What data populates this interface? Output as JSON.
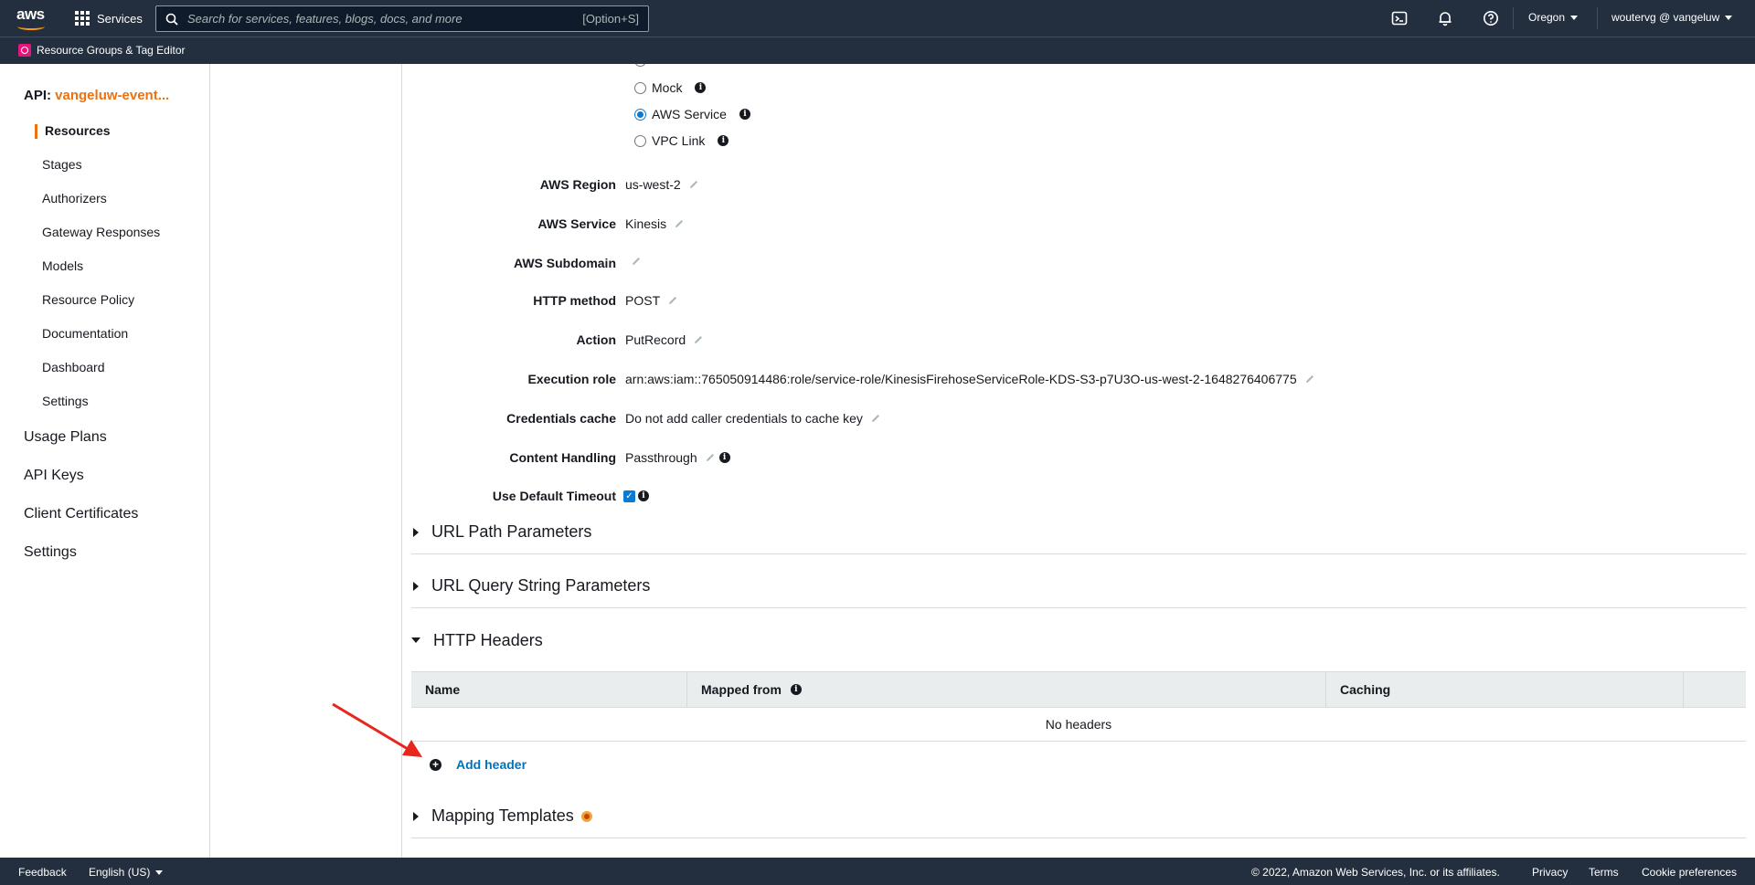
{
  "topnav": {
    "logo_text": "aws",
    "services_label": "Services",
    "search_placeholder": "Search for services, features, blogs, docs, and more",
    "search_shortcut": "[Option+S]",
    "region": "Oregon",
    "user": "woutervg @ vangeluw"
  },
  "subnav": {
    "resource_groups_label": "Resource Groups & Tag Editor"
  },
  "sidebar": {
    "api_prefix": "API:",
    "api_name": "vangeluw-event...",
    "items": [
      "Resources",
      "Stages",
      "Authorizers",
      "Gateway Responses",
      "Models",
      "Resource Policy",
      "Documentation",
      "Dashboard",
      "Settings"
    ],
    "top_items": [
      "Usage Plans",
      "API Keys",
      "Client Certificates",
      "Settings"
    ]
  },
  "integration": {
    "radios": [
      {
        "label": "Mock",
        "checked": false
      },
      {
        "label": "AWS Service",
        "checked": true
      },
      {
        "label": "VPC Link",
        "checked": false
      }
    ],
    "fields": [
      {
        "label": "AWS Region",
        "value": "us-west-2"
      },
      {
        "label": "AWS Service",
        "value": "Kinesis"
      },
      {
        "label": "AWS Subdomain",
        "value": ""
      },
      {
        "label": "HTTP method",
        "value": "POST"
      },
      {
        "label": "Action",
        "value": "PutRecord"
      },
      {
        "label": "Execution role",
        "value": "arn:aws:iam::765050914486:role/service-role/KinesisFirehoseServiceRole-KDS-S3-p7U3O-us-west-2-1648276406775"
      },
      {
        "label": "Credentials cache",
        "value": "Do not add caller credentials to cache key"
      },
      {
        "label": "Content Handling",
        "value": "Passthrough"
      },
      {
        "label": "Use Default Timeout",
        "value": "",
        "checked": true
      }
    ]
  },
  "sections": {
    "url_path": "URL Path Parameters",
    "url_query": "URL Query String Parameters",
    "http_headers": "HTTP Headers",
    "mapping_templates": "Mapping Templates"
  },
  "headers_table": {
    "columns": [
      "Name",
      "Mapped from",
      "Caching"
    ],
    "empty_text": "No headers",
    "add_label": "Add header"
  },
  "footer": {
    "feedback": "Feedback",
    "language": "English (US)",
    "copyright": "© 2022, Amazon Web Services, Inc. or its affiliates.",
    "privacy": "Privacy",
    "terms": "Terms",
    "cookies": "Cookie preferences"
  },
  "colors": {
    "nav_bg": "#232f3e",
    "accent_orange": "#ec7211",
    "link_blue": "#0073bb",
    "annotation_red": "#e8261c"
  }
}
